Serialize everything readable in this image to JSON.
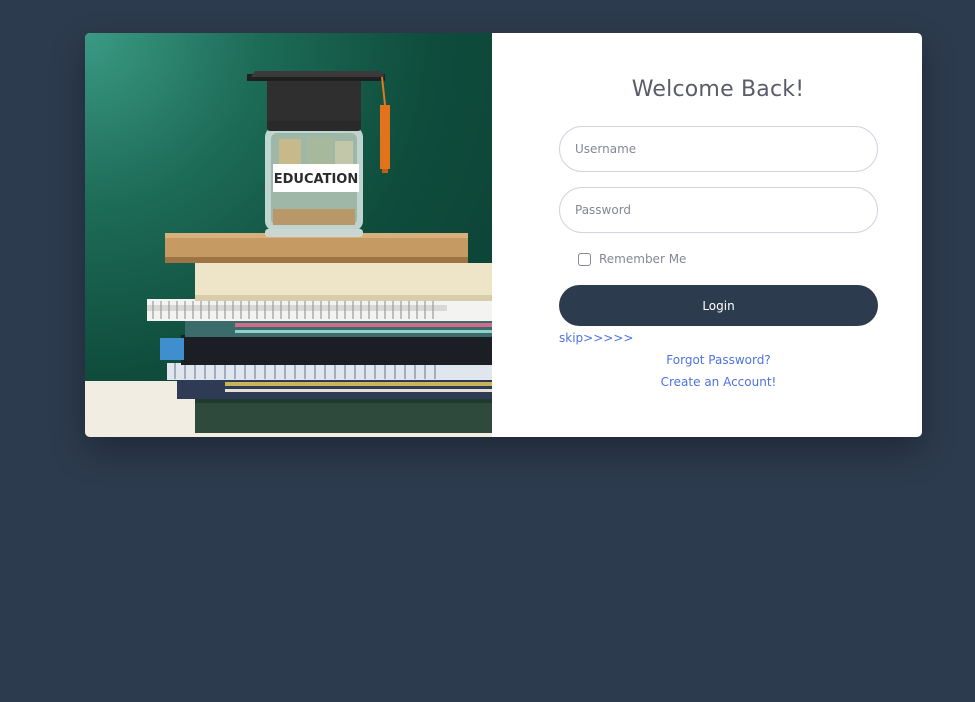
{
  "login": {
    "title": "Welcome Back!",
    "username_placeholder": "Username",
    "password_placeholder": "Password",
    "remember_label": "Remember Me",
    "remember_checked": false,
    "login_label": "Login",
    "skip_label": "skip>>>>>",
    "forgot_label": "Forgot Password?",
    "create_label": "Create an Account!"
  },
  "image": {
    "jar_label": "EDUCATION"
  },
  "colors": {
    "page_background": "#2d3b4e",
    "card_background": "#ffffff",
    "button_background": "#2d3b4e",
    "link": "#4e73df",
    "photo_background": "#0f4c3c"
  }
}
